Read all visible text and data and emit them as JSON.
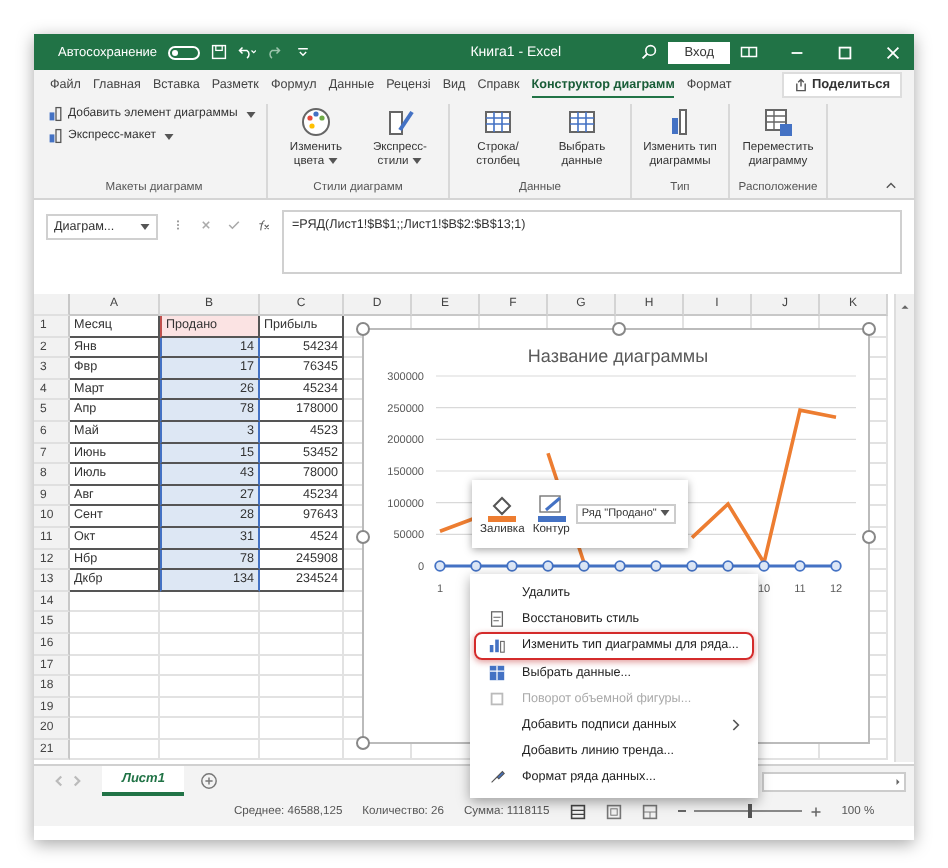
{
  "window": {
    "title": "Книга1 - Excel",
    "autosave": {
      "label": "Автосохранение",
      "on": false
    },
    "sign_in": "Вход"
  },
  "tabs": [
    {
      "label": "Файл",
      "selected": false
    },
    {
      "label": "Главная",
      "selected": false
    },
    {
      "label": "Вставка",
      "selected": false
    },
    {
      "label": "Разметк",
      "selected": false
    },
    {
      "label": "Формул",
      "selected": false
    },
    {
      "label": "Данные",
      "selected": false
    },
    {
      "label": "Рецензі",
      "selected": false
    },
    {
      "label": "Вид",
      "selected": false
    },
    {
      "label": "Справк",
      "selected": false
    },
    {
      "label": "Конструктор диаграмм",
      "selected": true
    },
    {
      "label": "Формат",
      "selected": false
    }
  ],
  "share": "Поделиться",
  "ribbon": {
    "groups": [
      {
        "label": "Макеты диаграмм",
        "kind": "small",
        "buttons": [
          {
            "label": "Добавить элемент диаграммы",
            "dropdown": true
          },
          {
            "label": "Экспресс-макет",
            "dropdown": true
          }
        ]
      },
      {
        "label": "Стили диаграмм",
        "kind": "large",
        "buttons": [
          {
            "label": "Изменить цвета",
            "dropdown": true
          },
          {
            "label": "Экспресс-стили",
            "dropdown": true
          }
        ]
      },
      {
        "label": "Данные",
        "kind": "large",
        "buttons": [
          {
            "label": "Строка/ столбец",
            "dropdown": false
          },
          {
            "label": "Выбрать данные",
            "dropdown": false
          }
        ]
      },
      {
        "label": "Тип",
        "kind": "large",
        "buttons": [
          {
            "label": "Изменить тип диаграммы",
            "dropdown": false
          }
        ]
      },
      {
        "label": "Расположение",
        "kind": "large",
        "buttons": [
          {
            "label": "Переместить диаграмму",
            "dropdown": false
          }
        ]
      }
    ]
  },
  "formula_bar": {
    "name_box": "Диаграм...",
    "formula": "=РЯД(Лист1!$B$1;;Лист1!$B$2:$B$13;1)"
  },
  "table": {
    "columns": [
      {
        "label": "A",
        "series": false
      },
      {
        "label": "B",
        "series": true
      },
      {
        "label": "C",
        "series": false
      },
      {
        "label": "D",
        "series": false
      },
      {
        "label": "E",
        "series": false
      },
      {
        "label": "F",
        "series": false
      },
      {
        "label": "G",
        "series": false
      },
      {
        "label": "H",
        "series": false
      },
      {
        "label": "I",
        "series": false
      },
      {
        "label": "J",
        "series": false
      },
      {
        "label": "K",
        "series": false
      }
    ],
    "rows": [
      {
        "number": "1",
        "cells": [
          "Месяц",
          "Продано",
          "Прибыль"
        ]
      },
      {
        "number": "2",
        "cells": [
          "Янв",
          "14",
          "54234"
        ]
      },
      {
        "number": "3",
        "cells": [
          "Фвр",
          "17",
          "76345"
        ]
      },
      {
        "number": "4",
        "cells": [
          "Март",
          "26",
          "45234"
        ]
      },
      {
        "number": "5",
        "cells": [
          "Апр",
          "78",
          "178000"
        ]
      },
      {
        "number": "6",
        "cells": [
          "Май",
          "3",
          "4523"
        ]
      },
      {
        "number": "7",
        "cells": [
          "Июнь",
          "15",
          "53452"
        ]
      },
      {
        "number": "8",
        "cells": [
          "Июль",
          "43",
          "78000"
        ]
      },
      {
        "number": "9",
        "cells": [
          "Авг",
          "27",
          "45234"
        ]
      },
      {
        "number": "10",
        "cells": [
          "Сент",
          "28",
          "97643"
        ]
      },
      {
        "number": "11",
        "cells": [
          "Окт",
          "31",
          "4524"
        ]
      },
      {
        "number": "12",
        "cells": [
          "Нбр",
          "78",
          "245908"
        ]
      },
      {
        "number": "13",
        "cells": [
          "Дкбр",
          "134",
          "234524"
        ]
      },
      {
        "number": "14",
        "cells": []
      },
      {
        "number": "15",
        "cells": []
      },
      {
        "number": "16",
        "cells": []
      },
      {
        "number": "17",
        "cells": []
      },
      {
        "number": "18",
        "cells": []
      },
      {
        "number": "19",
        "cells": []
      },
      {
        "number": "20",
        "cells": []
      },
      {
        "number": "21",
        "cells": []
      }
    ]
  },
  "chart": {
    "chart_data": {
      "type": "line",
      "title": "Название диаграммы",
      "categories": [
        "1",
        null,
        null,
        null,
        null,
        null,
        null,
        null,
        null,
        "10",
        "11",
        "12"
      ],
      "series": [
        {
          "color": "#4472c4",
          "marker": "circle",
          "values": [
            0,
            0,
            0,
            0,
            0,
            0,
            0,
            0,
            0,
            0,
            0,
            0
          ]
        },
        {
          "color": "#ed7d31",
          "values": [
            55000,
            76000,
            null,
            178000,
            5000,
            null,
            null,
            45000,
            98000,
            5000,
            246000,
            235000
          ]
        }
      ],
      "ylim": [
        0,
        300000
      ],
      "yticks": [
        0,
        50000,
        100000,
        150000,
        200000,
        250000,
        300000
      ],
      "grid": true
    }
  },
  "mini_toolbar": {
    "fill": "Заливка",
    "outline": "Контур",
    "series_picker": "Ряд \"Продано\""
  },
  "context_menu": [
    {
      "label": "Удалить",
      "kind": "plain",
      "disabled": false,
      "highlighted": false,
      "submenu": false
    },
    {
      "label": "Восстановить стиль",
      "kind": "reset",
      "disabled": false,
      "highlighted": false,
      "submenu": false
    },
    {
      "label": "Изменить тип диаграммы для ряда...",
      "kind": "chart",
      "disabled": false,
      "highlighted": true,
      "submenu": false
    },
    {
      "label": "Выбрать данные...",
      "kind": "data",
      "disabled": false,
      "highlighted": false,
      "submenu": false
    },
    {
      "label": "Поворот объемной фигуры...",
      "kind": "rotate",
      "disabled": true,
      "highlighted": false,
      "submenu": false
    },
    {
      "label": "Добавить подписи данных",
      "kind": "plain",
      "disabled": false,
      "highlighted": false,
      "submenu": true
    },
    {
      "label": "Добавить линию тренда...",
      "kind": "plain",
      "disabled": false,
      "highlighted": false,
      "submenu": false
    },
    {
      "label": "Формат ряда данных...",
      "kind": "format",
      "disabled": false,
      "highlighted": false,
      "submenu": false
    }
  ],
  "sheet_tabs": [
    {
      "label": "Лист1",
      "selected": true
    }
  ],
  "status_bar": {
    "average": "Среднее: 46588,125",
    "count": "Количество: 26",
    "sum": "Сумма: 1118115",
    "zoom": {
      "level": 0.5,
      "reading": "100 %"
    }
  }
}
